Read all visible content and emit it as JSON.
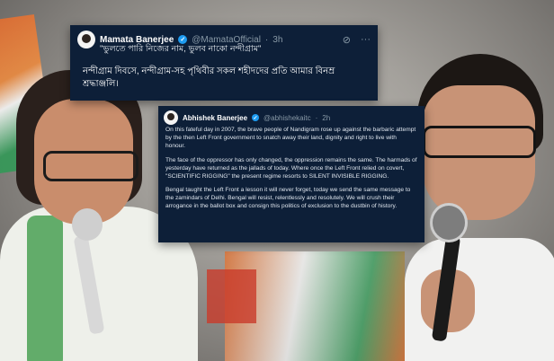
{
  "tweet1": {
    "author_name": "Mamata Banerjee",
    "handle": "@MamataOfficial",
    "separator": "·",
    "time": "3h",
    "quote": "\"ভুলতে পারি নিজের নাম, ভুলব নাকো নন্দীগ্রাম\"",
    "body": "নন্দীগ্রাম দিবসে, নন্দীগ্রাম-সহ পৃথিবীর সকল শহীদদের প্রতি আমার বিনম্র শ্রদ্ধাঞ্জলি।"
  },
  "tweet2": {
    "author_name": "Abhishek Banerjee",
    "handle": "@abhishekaitc",
    "separator": "·",
    "time": "2h",
    "paragraphs": [
      "On this fateful day in 2007, the brave people of Nandigram rose up against the barbaric attempt by the then Left Front government to snatch away their land, dignity and right to live with honour.",
      "The face of the oppressor has only changed, the oppression remains the same. The harmads of yesterday have returned as the jallads of today. Where once the Left Front relied on covert, \"SCIENTIFIC RIGGING\" the present regime resorts to SILENT INVISIBLE RIGGING.",
      "Bengal taught the Left Front a lesson it will never forget, today we send the same message to the zamindars of Delhi. Bengal will resist, relentlessly and resolutely. We will crush their arrogance in the ballot box and consign this politics of exclusion to the dustbin of history."
    ]
  },
  "icons": {
    "verified": "✓",
    "grok": "⊘",
    "more": "···"
  },
  "colors": {
    "card_bg": "#0d1f38",
    "verified_blue": "#1d9bf0",
    "muted": "#8899a6"
  }
}
